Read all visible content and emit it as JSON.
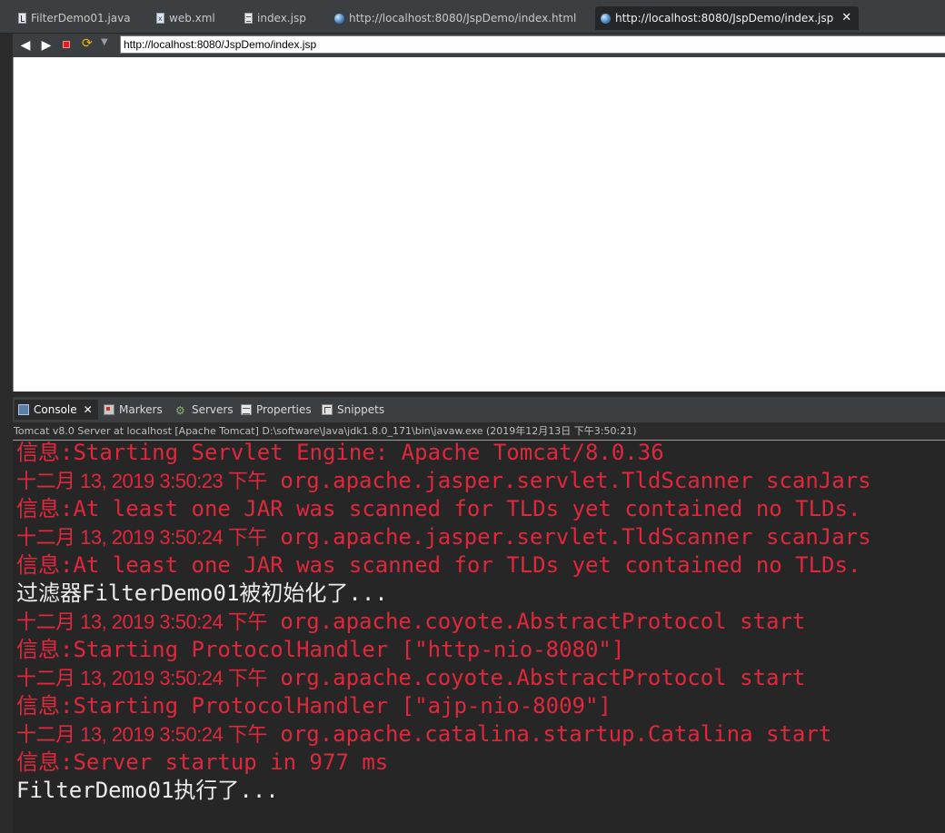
{
  "editor_tabs": [
    {
      "label": "FilterDemo01.java",
      "icon": "java-file-icon"
    },
    {
      "label": "web.xml",
      "icon": "xml-file-icon"
    },
    {
      "label": "index.jsp",
      "icon": "jsp-file-icon"
    },
    {
      "label": "http://localhost:8080/JspDemo/index.html",
      "icon": "globe-icon"
    },
    {
      "label": "http://localhost:8080/JspDemo/index.jsp",
      "icon": "globe-icon",
      "active": true
    }
  ],
  "browser": {
    "url": "http://localhost:8080/JspDemo/index.jsp"
  },
  "view_tabs": [
    {
      "label": "Console",
      "icon": "console-icon",
      "active": true
    },
    {
      "label": "Markers",
      "icon": "markers-icon"
    },
    {
      "label": "Servers",
      "icon": "servers-icon"
    },
    {
      "label": "Properties",
      "icon": "properties-icon"
    },
    {
      "label": "Snippets",
      "icon": "snippets-icon"
    }
  ],
  "console": {
    "header": "Tomcat v8.0 Server at localhost [Apache Tomcat] D:\\software\\Java\\jdk1.8.0_171\\bin\\javaw.exe (2019年12月13日 下午3:50:21)",
    "lines": [
      {
        "color": "red",
        "prefix": "信息:",
        "text": "Starting Servlet Engine: Apache Tomcat/8.0.36"
      },
      {
        "color": "red",
        "date": "十二月 13, 2019 3:50:23 下午",
        "text": "org.apache.jasper.servlet.TldScanner scanJars"
      },
      {
        "color": "red",
        "prefix": "信息:",
        "text": "At least one JAR was scanned for TLDs yet contained no TLDs."
      },
      {
        "color": "red",
        "date": "十二月 13, 2019 3:50:24 下午",
        "text": "org.apache.jasper.servlet.TldScanner scanJars"
      },
      {
        "color": "red",
        "prefix": "信息:",
        "text": "At least one JAR was scanned for TLDs yet contained no TLDs."
      },
      {
        "color": "white",
        "text": "过滤器FilterDemo01被初始化了..."
      },
      {
        "color": "red",
        "date": "十二月 13, 2019 3:50:24 下午",
        "text": "org.apache.coyote.AbstractProtocol start"
      },
      {
        "color": "red",
        "prefix": "信息:",
        "text": "Starting ProtocolHandler [\"http-nio-8080\"]"
      },
      {
        "color": "red",
        "date": "十二月 13, 2019 3:50:24 下午",
        "text": "org.apache.coyote.AbstractProtocol start"
      },
      {
        "color": "red",
        "prefix": "信息:",
        "text": "Starting ProtocolHandler [\"ajp-nio-8009\"]"
      },
      {
        "color": "red",
        "date": "十二月 13, 2019 3:50:24 下午",
        "text": "org.apache.catalina.startup.Catalina start"
      },
      {
        "color": "red",
        "prefix": "信息:",
        "text": "Server startup in 977 ms"
      },
      {
        "color": "white",
        "text": "FilterDemo01执行了..."
      }
    ]
  },
  "colors": {
    "console_red": "#e0283c",
    "console_white": "#ececec",
    "chrome_bg": "#3c3f41"
  }
}
